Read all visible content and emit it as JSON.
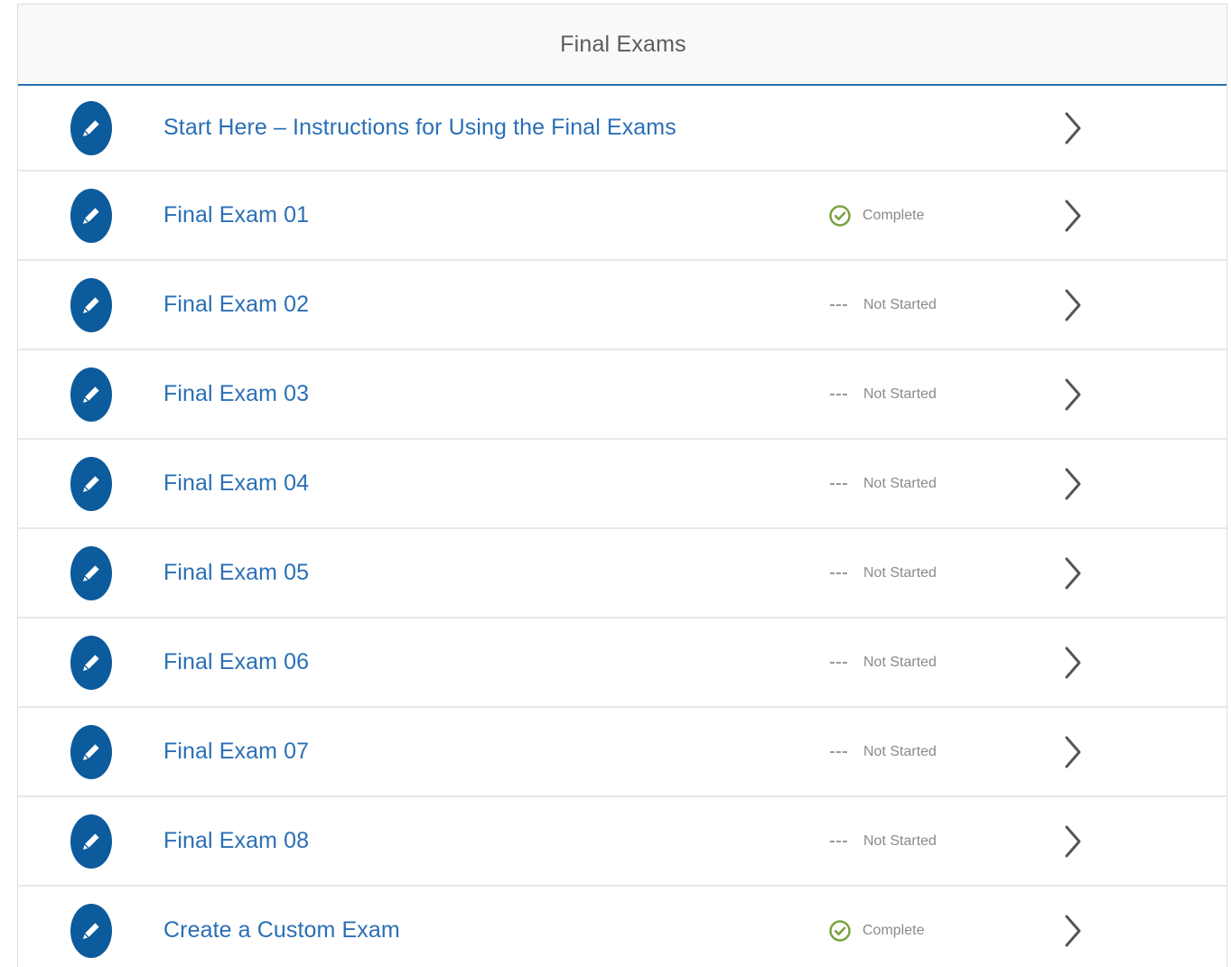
{
  "panel": {
    "title": "Final Exams"
  },
  "colors": {
    "accent": "#2a6fb0",
    "icon_bg": "#0c5b9c",
    "link": "#2a6fb6",
    "complete": "#7ba23f",
    "muted": "#8a8a8a"
  },
  "rows": [
    {
      "title": "Start Here – Instructions for Using the Final Exams",
      "status": "",
      "status_type": "none",
      "icon": "pencil-icon"
    },
    {
      "title": "Final Exam 01",
      "status": "Complete",
      "status_type": "complete",
      "icon": "pencil-icon"
    },
    {
      "title": "Final Exam 02",
      "status": "Not Started",
      "status_type": "not-started",
      "icon": "pencil-icon"
    },
    {
      "title": "Final Exam 03",
      "status": "Not Started",
      "status_type": "not-started",
      "icon": "pencil-icon"
    },
    {
      "title": "Final Exam 04",
      "status": "Not Started",
      "status_type": "not-started",
      "icon": "pencil-icon"
    },
    {
      "title": "Final Exam 05",
      "status": "Not Started",
      "status_type": "not-started",
      "icon": "pencil-icon"
    },
    {
      "title": "Final Exam 06",
      "status": "Not Started",
      "status_type": "not-started",
      "icon": "pencil-icon"
    },
    {
      "title": "Final Exam 07",
      "status": "Not Started",
      "status_type": "not-started",
      "icon": "pencil-icon"
    },
    {
      "title": "Final Exam 08",
      "status": "Not Started",
      "status_type": "not-started",
      "icon": "pencil-icon"
    },
    {
      "title": "Create a Custom Exam",
      "status": "Complete",
      "status_type": "complete",
      "icon": "pencil-icon"
    }
  ]
}
